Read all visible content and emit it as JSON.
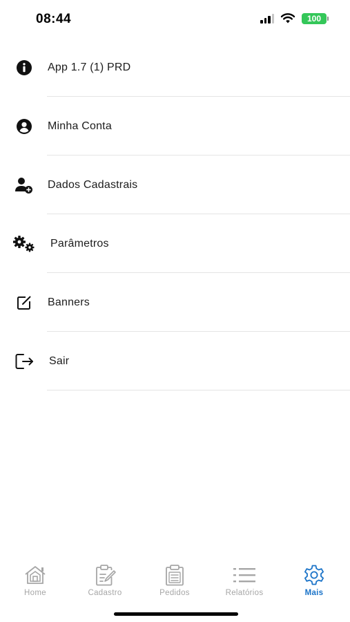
{
  "status_bar": {
    "time": "08:44",
    "battery": "100"
  },
  "menu": {
    "items": [
      {
        "label": "App 1.7 (1) PRD",
        "icon": "info-circle-icon"
      },
      {
        "label": "Minha Conta",
        "icon": "user-circle-icon"
      },
      {
        "label": "Dados Cadastrais",
        "icon": "user-plus-icon"
      },
      {
        "label": "Parâmetros",
        "icon": "gears-icon"
      },
      {
        "label": "Banners",
        "icon": "edit-square-icon"
      },
      {
        "label": "Sair",
        "icon": "logout-icon"
      }
    ]
  },
  "tabbar": {
    "tabs": [
      {
        "label": "Home",
        "icon": "home-icon",
        "active": false
      },
      {
        "label": "Cadastro",
        "icon": "clipboard-edit-icon",
        "active": false
      },
      {
        "label": "Pedidos",
        "icon": "clipboard-list-icon",
        "active": false
      },
      {
        "label": "Relatórios",
        "icon": "list-icon",
        "active": false
      },
      {
        "label": "Mais",
        "icon": "gear-icon",
        "active": true
      }
    ]
  },
  "colors": {
    "accent": "#1a73c8",
    "inactive": "#a6a6a6",
    "battery": "#34c759",
    "separator": "#e4e4e4"
  }
}
